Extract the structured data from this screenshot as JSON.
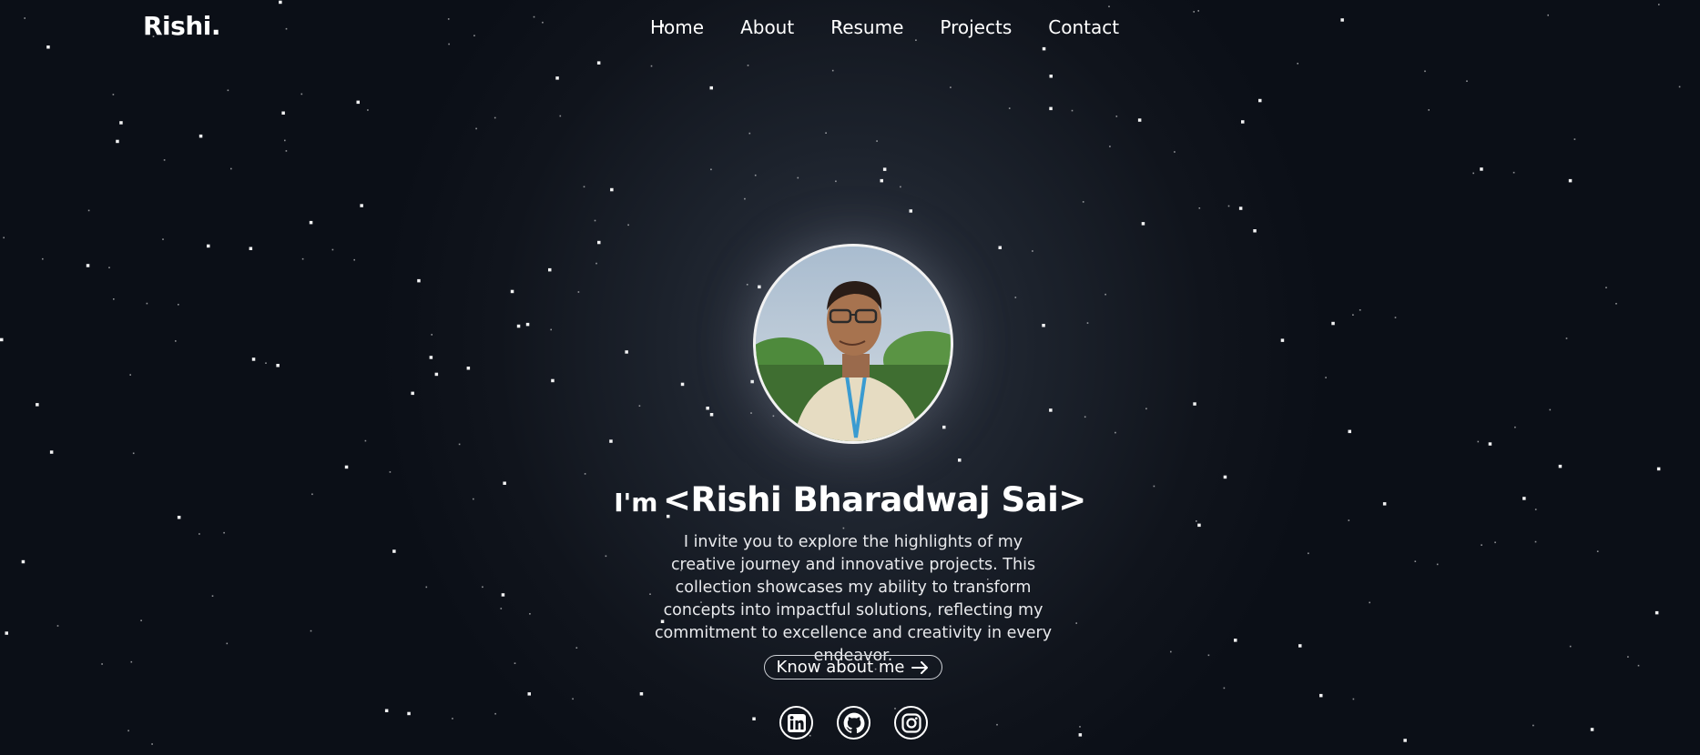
{
  "brand": {
    "logo_text": "Rishi."
  },
  "nav": {
    "items": [
      {
        "label": "Home"
      },
      {
        "label": "About"
      },
      {
        "label": "Resume"
      },
      {
        "label": "Projects"
      },
      {
        "label": "Contact"
      }
    ]
  },
  "hero": {
    "greeting": "I'm",
    "name": "<Rishi Bharadwaj Sai>",
    "bio": "I invite you to explore the highlights of my creative journey and innovative projects. This collection showcases my ability to transform concepts into impactful solutions, reflecting my commitment to excellence and creativity in every endeavor.",
    "cta_label": "Know about me",
    "cta_icon": "arrow-right-icon"
  },
  "social": {
    "items": [
      {
        "icon": "linkedin-icon"
      },
      {
        "icon": "github-icon"
      },
      {
        "icon": "instagram-icon"
      }
    ]
  },
  "colors": {
    "background": "#10141c",
    "text": "#ffffff",
    "star": "#ffffff"
  }
}
